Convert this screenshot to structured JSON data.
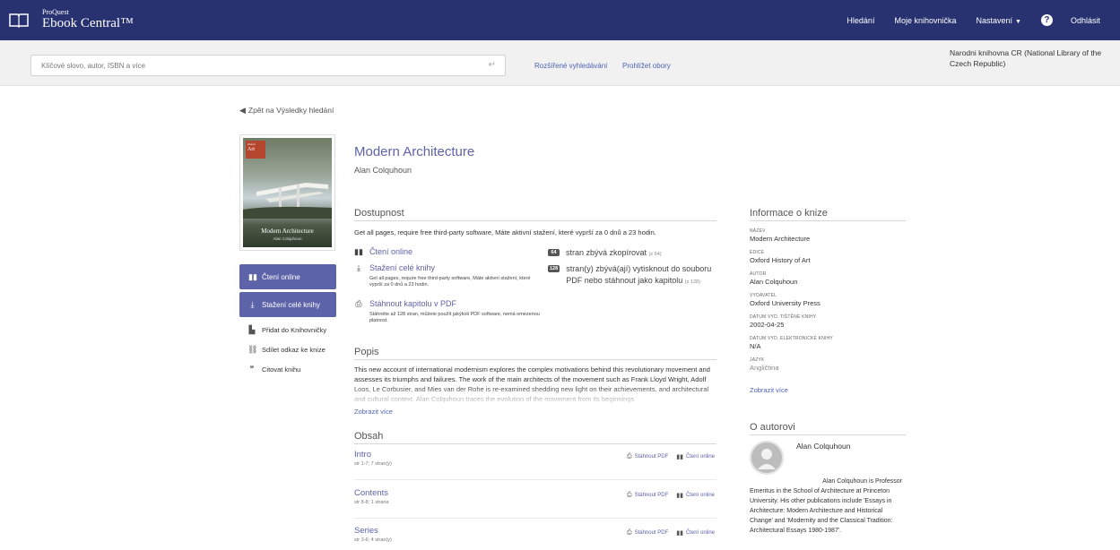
{
  "header": {
    "brand_small": "ProQuest",
    "brand_main": "Ebook Central™",
    "nav": {
      "search": "Hledání",
      "bookshelf": "Moje knihovnička",
      "settings": "Nastavení",
      "logout": "Odhlásit"
    },
    "accent": "#283270"
  },
  "search": {
    "placeholder": "Klíčové slovo, autor, ISBN a více",
    "advanced": "Rozšířené vyhledávání",
    "browse": "Prohlížet obory"
  },
  "library": "Narodni knihovna CR (National Library of the Czech Republic)",
  "back_link": "Zpět na Výsledky hledání",
  "book": {
    "title": "Modern Architecture",
    "author": "Alan Colquhoun",
    "cover": {
      "series_word": "Art",
      "series_prefix": "Oxford",
      "title": "Modern Architecture",
      "author": "Alan Colquhoun"
    }
  },
  "side_actions": {
    "read_online": "Čtení online",
    "download": "Stažení celé knihy",
    "add_shelf": "Přidat do Knihovničky",
    "share": "Sdílet odkaz ke knize",
    "cite": "Citovat knihu"
  },
  "availability": {
    "heading": "Dostupnost",
    "note": "Get all pages, require free third-party software, Máte aktivní stažení, které vyprší za 0 dnů a 23 hodin.",
    "read_online": "Čtení online",
    "download": "Stažení celé knihy",
    "download_sub": "Get all pages, require free third-party software, Máte aktivní stažení, které vyprší za 0 dnů a 23 hodin.",
    "chapter_pdf": "Stáhnout kapitolu v PDF",
    "chapter_pdf_sub": "Stáhněte až 128 stran, můžete použít jakýkoli PDF software, nemá omezenou platnost.",
    "copy_badge": "64",
    "copy_text": "stran zbývá zkopírovat",
    "copy_small": "(z 64)",
    "print_badge": "128",
    "print_text": "stran(y) zbývá(ají) vytisknout do souboru PDF nebo stáhnout jako kapitolu",
    "print_small": "(z 128)"
  },
  "description": {
    "heading": "Popis",
    "text": "This new account of international modernism explores the complex motivations behind this revolutionary movement and assesses its triumphs and failures. The work of the main architects of the movement such as Frank Lloyd Wright, Adolf Loos, Le Corbusier, and Mies van der Rohe is re-examined shedding new light on their achievements, and architectural and cultural context. Alan Colquhoun traces the evolution of the movement from its beginnings",
    "show_more": "Zobrazit více"
  },
  "toc": {
    "heading": "Obsah",
    "download_label": "Stáhnout PDF",
    "read_label": "Čtení online",
    "items": [
      {
        "title": "Intro",
        "pages": "str 1-7; 7 stran(y)"
      },
      {
        "title": "Contents",
        "pages": "str 8-8; 1 strana"
      },
      {
        "title": "Series",
        "pages": "str 3-6; 4 stran(y)"
      }
    ]
  },
  "info": {
    "heading": "Informace o knize",
    "fields": [
      {
        "label": "NÁZEV",
        "value": "Modern Architecture"
      },
      {
        "label": "EDICE",
        "value": "Oxford History of Art"
      },
      {
        "label": "AUTOR",
        "value": "Alan Colquhoun"
      },
      {
        "label": "VYDAVATEL",
        "value": "Oxford University Press"
      },
      {
        "label": "DATUM VYD. TIŠTĚNÉ KNIHY",
        "value": "2002-04-25"
      },
      {
        "label": "DATUM VYD. ELEKTRONICKÉ KNIHY",
        "value": "N/A"
      },
      {
        "label": "JAZYK",
        "value": "Angličtina"
      }
    ],
    "show_more": "Zobrazit více"
  },
  "about_author": {
    "heading": "O autorovi",
    "name": "Alan Colquhoun",
    "bio_first": "Alan Colquhoun is Professor",
    "bio_rest": "Emeritus in the School of Architecture at Princeton University. His other publications include 'Essays in Architecture: Modern Architecture and Historical Change' and 'Modernity and the Classical Tradition: Architectural Essays 1980-1987'."
  }
}
